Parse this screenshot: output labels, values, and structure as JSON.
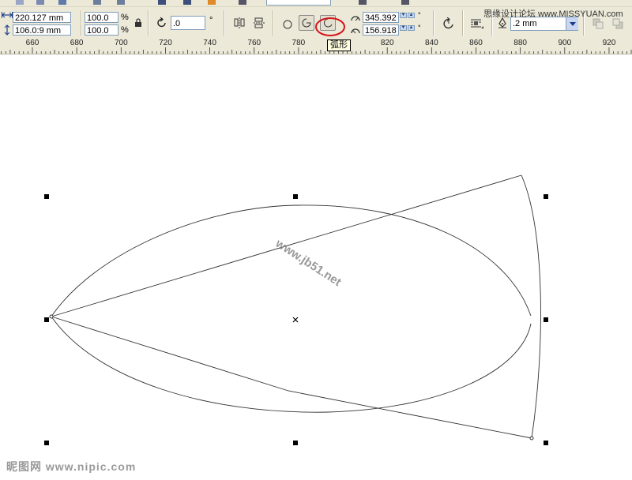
{
  "toolbar": {
    "width_value": "220.127 mm",
    "height_value": "106.0:9 mm",
    "scale_x": "100.0",
    "scale_y": "100.0",
    "percent_symbol": "%",
    "rotation_value": ".0",
    "degree_symbol": "°",
    "start_angle": "345.392",
    "end_angle": "156.918",
    "outline_width": ".2 mm",
    "ellipse_tool_icon": "ellipse-icon",
    "pie_tool_icon": "pie-icon",
    "arc_tool_icon": "arc-icon",
    "highlight_color": "#d4141a"
  },
  "tooltip": {
    "text": "弧形"
  },
  "site_watermark": "思缘设计论坛 www.MISSYUAN.com",
  "ruler": {
    "labels": [
      "660",
      "680",
      "700",
      "720",
      "740",
      "760",
      "780",
      "800",
      "820",
      "840",
      "860",
      "880",
      "900",
      "920"
    ]
  },
  "canvas": {
    "watermark": "www.jb51.net",
    "bottom_watermark": "昵图网 www.nipic.com"
  }
}
